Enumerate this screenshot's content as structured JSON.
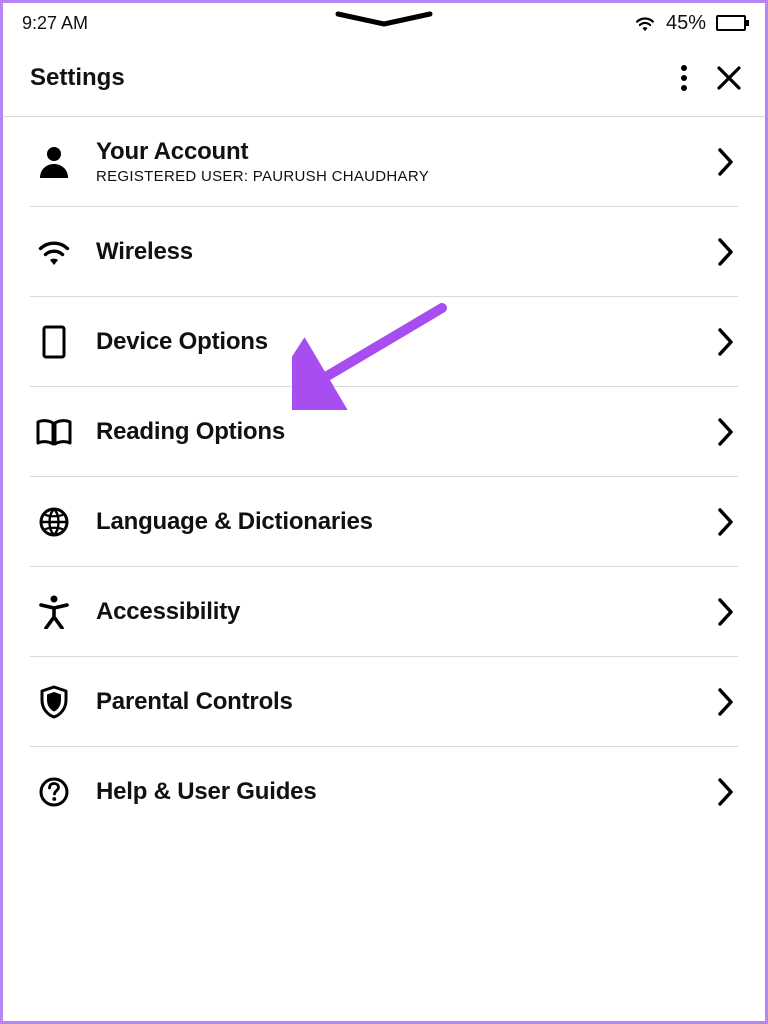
{
  "status": {
    "time": "9:27 AM",
    "battery_pct_label": "45%",
    "battery_level": 45
  },
  "header": {
    "title": "Settings"
  },
  "rows": {
    "account": {
      "title": "Your Account",
      "subtitle": "REGISTERED USER: PAURUSH CHAUDHARY"
    },
    "wireless": {
      "title": "Wireless"
    },
    "device": {
      "title": "Device Options"
    },
    "reading": {
      "title": "Reading Options"
    },
    "language": {
      "title": "Language & Dictionaries"
    },
    "accessibility": {
      "title": "Accessibility"
    },
    "parental": {
      "title": "Parental Controls"
    },
    "help": {
      "title": "Help & User Guides"
    }
  }
}
